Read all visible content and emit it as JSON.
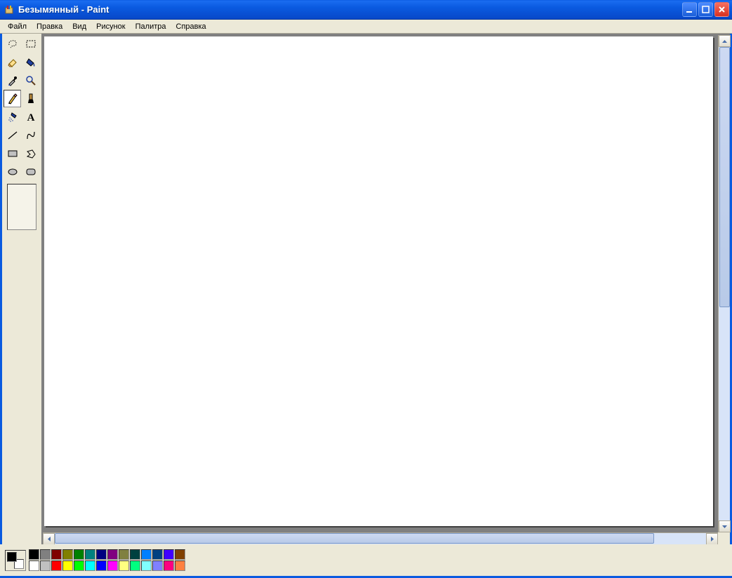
{
  "window": {
    "title": "Безымянный - Paint"
  },
  "menu": {
    "items": [
      "Файл",
      "Правка",
      "Вид",
      "Рисунок",
      "Палитра",
      "Справка"
    ]
  },
  "tools": [
    {
      "name": "free-select-tool"
    },
    {
      "name": "rect-select-tool"
    },
    {
      "name": "eraser-tool"
    },
    {
      "name": "fill-tool"
    },
    {
      "name": "eyedropper-tool"
    },
    {
      "name": "magnify-tool"
    },
    {
      "name": "pencil-tool",
      "selected": true
    },
    {
      "name": "brush-tool"
    },
    {
      "name": "airbrush-tool"
    },
    {
      "name": "text-tool"
    },
    {
      "name": "line-tool"
    },
    {
      "name": "curve-tool"
    },
    {
      "name": "rectangle-tool"
    },
    {
      "name": "polygon-tool"
    },
    {
      "name": "ellipse-tool"
    },
    {
      "name": "rounded-rect-tool"
    }
  ],
  "colors": {
    "foreground": "#000000",
    "background": "#ffffff",
    "palette_row1": [
      "#000000",
      "#808080",
      "#800000",
      "#808000",
      "#008000",
      "#008080",
      "#000080",
      "#800080",
      "#808040",
      "#004040",
      "#0080ff",
      "#004080",
      "#4000ff",
      "#804000"
    ],
    "palette_row2": [
      "#ffffff",
      "#c0c0c0",
      "#ff0000",
      "#ffff00",
      "#00ff00",
      "#00ffff",
      "#0000ff",
      "#ff00ff",
      "#ffff80",
      "#00ff80",
      "#80ffff",
      "#8080ff",
      "#ff0080",
      "#ff8040"
    ]
  }
}
